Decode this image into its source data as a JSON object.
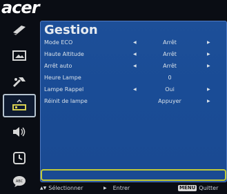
{
  "brand": {
    "logo_text": "acer"
  },
  "sidebar": {
    "items": [
      {
        "name": "color-icon"
      },
      {
        "name": "image-icon"
      },
      {
        "name": "settings-icon"
      },
      {
        "name": "management-icon"
      },
      {
        "name": "audio-icon"
      },
      {
        "name": "timer-icon"
      },
      {
        "name": "language-icon"
      }
    ]
  },
  "main": {
    "title": "Gestion",
    "rows": [
      {
        "label": "Mode ECO",
        "value": "Arrêt"
      },
      {
        "label": "Haute Altitude",
        "value": "Arrêt"
      },
      {
        "label": "Arrêt auto",
        "value": "Arrêt"
      },
      {
        "label": "Heure Lampe",
        "value": "0"
      },
      {
        "label": "Lampe Rappel",
        "value": "Oui"
      },
      {
        "label": "Réinit de lampe",
        "value": "Appuyer"
      }
    ]
  },
  "footer": {
    "select_label": "Sélectionner",
    "enter_label": "Entrer",
    "menu_key": "MENU",
    "quit_label": "Quitter"
  },
  "colors": {
    "panel": "#1b4d96",
    "status_border": "#c2cc38",
    "background": "#0a0d14"
  }
}
